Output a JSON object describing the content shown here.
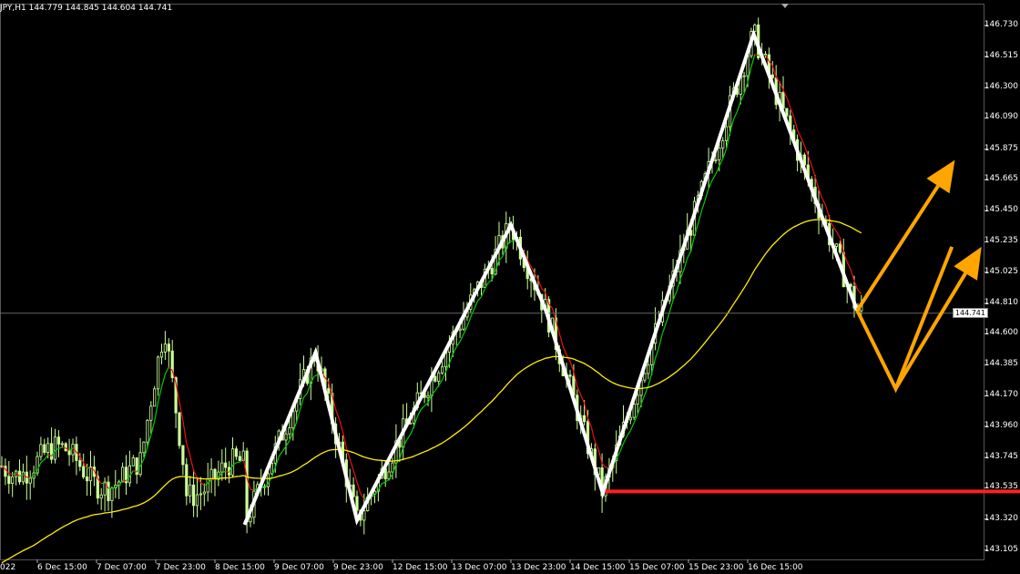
{
  "symbol_label": "JPY,H1  144.779 144.845 144.604 144.741",
  "chart_data": {
    "type": "candlestick",
    "x_labels": [
      "6 Dec 15:00",
      "7 Dec 07:00",
      "7 Dec 23:00",
      "8 Dec 15:00",
      "9 Dec 07:00",
      "9 Dec 23:00",
      "12 Dec 15:00",
      "13 Dec 07:00",
      "13 Dec 23:00",
      "14 Dec 15:00",
      "15 Dec 07:00",
      "15 Dec 23:00",
      "16 Dec 15:00"
    ],
    "x_first_partial": "022",
    "y_ticks": [
      146.73,
      146.515,
      146.3,
      146.09,
      145.875,
      145.665,
      145.45,
      145.235,
      145.025,
      144.81,
      144.6,
      144.385,
      144.17,
      143.96,
      143.745,
      143.535,
      143.32,
      143.105
    ],
    "ylim": [
      143.04,
      146.88
    ],
    "current_price": 144.741,
    "support_level": 143.51,
    "zigzag": [
      [
        7.0,
        143.28
      ],
      [
        9.4,
        144.47
      ],
      [
        10.8,
        143.31
      ],
      [
        16.0,
        145.35
      ],
      [
        17.2,
        144.75
      ],
      [
        19.1,
        143.5
      ],
      [
        24.2,
        146.67
      ],
      [
        27.7,
        144.76
      ]
    ],
    "projection": [
      [
        27.7,
        144.76
      ],
      [
        29.0,
        144.22
      ],
      [
        30.9,
        145.2
      ]
    ],
    "forecast_arrows": [
      [
        [
          27.7,
          144.76
        ],
        [
          31.0,
          145.8
        ]
      ],
      [
        [
          29.0,
          144.22
        ],
        [
          31.9,
          145.2
        ]
      ]
    ],
    "colors": {
      "candle": "#ccff99",
      "ma_fast_up": "#00cc00",
      "ma_fast_down": "#ee1111",
      "ma_slow": "#ffee00",
      "zigzag": "#ffffff",
      "projection": "#ffa500",
      "support": "#ff2020",
      "grid": "#666666"
    }
  }
}
